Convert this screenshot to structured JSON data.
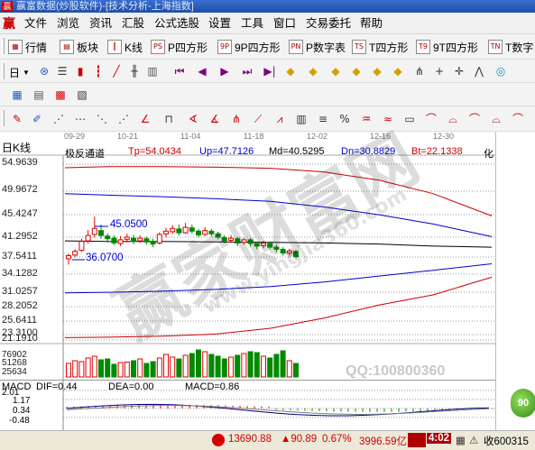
{
  "window": {
    "title": "赢富数据(炒股软件)-[技术分析-上海指数]",
    "logo_glyph": "赢"
  },
  "menu": {
    "logo_glyph": "赢",
    "items": [
      "文件",
      "浏览",
      "资讯",
      "汇股",
      "公式选股",
      "设置",
      "工具",
      "窗口",
      "交易委托",
      "帮助"
    ]
  },
  "toolbar1": {
    "buttons": [
      {
        "label": "行情",
        "icon": "grid-icon"
      },
      {
        "label": "板块",
        "icon": "blocks-icon"
      },
      {
        "label": "K线",
        "icon": "candle-icon"
      },
      {
        "label": "P四方形",
        "icon": "ps-icon",
        "glyph": "PS"
      },
      {
        "label": "9P四方形",
        "icon": "9p-icon",
        "glyph": "9P"
      },
      {
        "label": "P数字表",
        "icon": "pn-icon",
        "glyph": "PN"
      },
      {
        "label": "T四方形",
        "icon": "ts-icon",
        "glyph": "TS"
      },
      {
        "label": "9T四方形",
        "icon": "9t-icon",
        "glyph": "T9"
      },
      {
        "label": "T数字",
        "icon": "tn-icon",
        "glyph": "TN"
      }
    ]
  },
  "toolbar2": {
    "period_label": "日"
  },
  "toolbar4": {
    "percent_glyph": "%"
  },
  "chart": {
    "period_label": "日K线",
    "indicator_name": "极反通道",
    "tp": "Tp=54.0434",
    "up": "Up=47.7126",
    "md": "Md=40.5295",
    "dn": "Dn=30.8829",
    "bt": "Bt=22.1338",
    "corner_label": "化",
    "y_ticks": [
      "54.9639",
      "49.9672",
      "45.4247",
      "41.2952",
      "37.5411",
      "34.1282",
      "31.0257",
      "28.2052",
      "25.6411",
      "23.3100",
      "21.1910"
    ],
    "x_ticks": [
      "09-29",
      "10-21",
      "11-04",
      "11-18",
      "12-02",
      "12-16",
      "12-30"
    ],
    "annotations": {
      "high": "45.0500",
      "low": "36.0700"
    },
    "volume_ticks": [
      "76902",
      "51268",
      "25634"
    ],
    "watermark_qq": "QQ:100800360",
    "watermark_big": "赢家财富网",
    "watermark_url": "www.yingjia360.com"
  },
  "chart_data": {
    "type": "candlestick",
    "series": [
      {
        "name": "Tp",
        "last": 54.0434
      },
      {
        "name": "Up",
        "last": 47.7126
      },
      {
        "name": "Md",
        "last": 40.5295
      },
      {
        "name": "Dn",
        "last": 30.8829
      },
      {
        "name": "Bt",
        "last": 22.1338
      }
    ],
    "y_ticks": [
      54.9639,
      49.9672,
      45.4247,
      41.2952,
      37.5411,
      34.1282,
      31.0257,
      28.2052,
      25.6411,
      23.31,
      21.191
    ],
    "candles": [
      [
        37.2,
        37.8,
        36.07,
        38.2
      ],
      [
        37.9,
        38.6,
        37.5,
        39.0
      ],
      [
        38.8,
        40.5,
        38.5,
        41.0
      ],
      [
        40.6,
        41.6,
        40.1,
        42.6
      ],
      [
        41.8,
        42.9,
        41.2,
        45.05
      ],
      [
        42.5,
        41.6,
        41.0,
        43.6
      ],
      [
        41.5,
        41.0,
        40.3,
        42.0
      ],
      [
        41.1,
        40.2,
        39.8,
        41.6
      ],
      [
        40.1,
        40.8,
        39.6,
        41.5
      ],
      [
        40.9,
        41.3,
        40.3,
        41.9
      ],
      [
        41.1,
        40.5,
        40.0,
        41.7
      ],
      [
        40.6,
        41.1,
        40.2,
        41.6
      ],
      [
        41.0,
        40.4,
        39.9,
        41.4
      ],
      [
        40.5,
        40.0,
        39.4,
        41.0
      ],
      [
        40.2,
        41.8,
        39.9,
        42.2
      ],
      [
        41.9,
        42.4,
        41.3,
        43.0
      ],
      [
        42.3,
        42.9,
        41.9,
        43.5
      ],
      [
        42.8,
        42.1,
        41.6,
        43.6
      ],
      [
        42.1,
        43.1,
        41.9,
        43.9
      ],
      [
        43.0,
        42.4,
        41.9,
        43.6
      ],
      [
        42.4,
        41.7,
        41.2,
        42.8
      ],
      [
        41.8,
        42.5,
        41.5,
        43.1
      ],
      [
        42.4,
        41.9,
        41.4,
        42.8
      ],
      [
        41.9,
        41.3,
        40.9,
        42.3
      ],
      [
        41.2,
        40.6,
        40.1,
        41.7
      ],
      [
        40.7,
        41.1,
        40.3,
        41.7
      ],
      [
        41.0,
        40.2,
        39.6,
        41.3
      ],
      [
        40.3,
        40.8,
        39.9,
        41.2
      ],
      [
        40.8,
        40.1,
        39.5,
        41.1
      ],
      [
        40.1,
        39.6,
        39.0,
        40.5
      ],
      [
        39.7,
        40.2,
        39.2,
        40.6
      ],
      [
        40.1,
        39.4,
        38.9,
        40.5
      ],
      [
        39.4,
        39.0,
        38.4,
        39.9
      ],
      [
        39.0,
        38.3,
        37.8,
        39.4
      ],
      [
        38.3,
        38.7,
        37.9,
        39.1
      ],
      [
        38.6,
        37.6,
        37.2,
        38.9
      ]
    ],
    "volumes": [
      30,
      36,
      34,
      42,
      46,
      38,
      40,
      28,
      32,
      33,
      36,
      40,
      30,
      34,
      42,
      50,
      44,
      40,
      48,
      52,
      60,
      56,
      50,
      46,
      40,
      44,
      48,
      52,
      56,
      54,
      46,
      42,
      50,
      58,
      36,
      30
    ],
    "volume_ticks": [
      76902,
      51268,
      25634
    ],
    "macd": {
      "DIF": 0.44,
      "DEA": 0.0,
      "MACD": 0.86,
      "y_ticks": [
        2.01,
        1.17,
        0.34,
        -0.48
      ]
    }
  },
  "macd": {
    "label": "MACD",
    "dif": "DIF=0.44",
    "dea": "DEA=0.00",
    "macd": "MACD=0.86",
    "y_ticks": [
      "2.01",
      "1.17",
      "0.34",
      "-0.48"
    ],
    "badge_text": "90"
  },
  "status": {
    "index_value": "13690.88",
    "change": "▲90.89",
    "pct": "0.67%",
    "amount": "3996.59亿",
    "time": "4:02",
    "right_text": "收600315"
  },
  "colors": {
    "up": "#e00000",
    "down": "#008a00",
    "tp": "#cc0000",
    "up_line": "#0000cc",
    "md": "#000000"
  }
}
